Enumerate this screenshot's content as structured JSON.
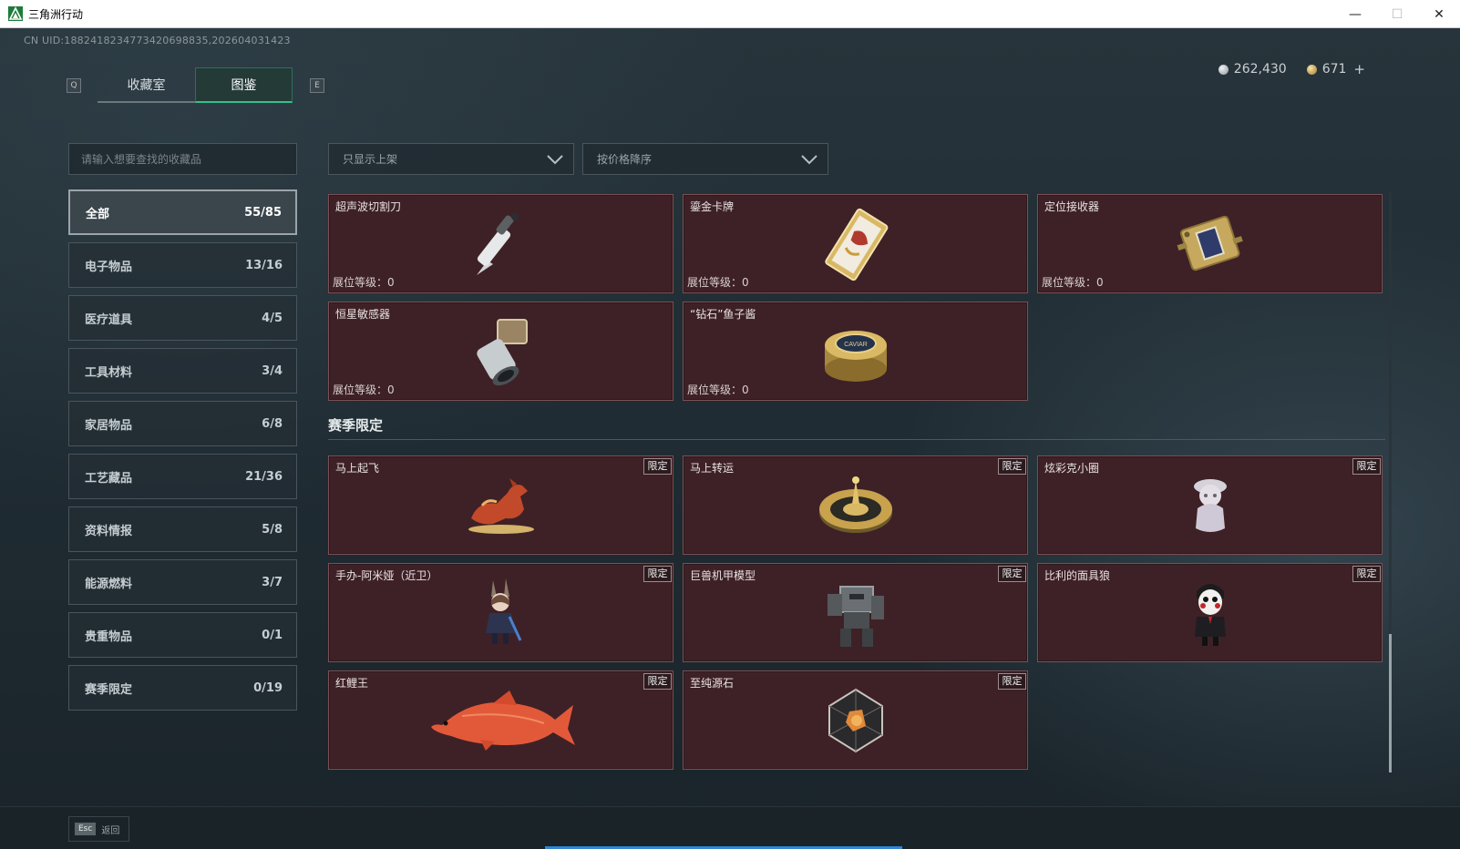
{
  "window": {
    "title": "三角洲行动",
    "minimize": "—",
    "maximize": "☐",
    "close": "✕"
  },
  "uid": "CN UID:1882418234773420698835,202604031423",
  "currency": {
    "silver": "262,430",
    "gold": "671",
    "plus": "+"
  },
  "tabs": {
    "prev_key": "Q",
    "next_key": "E",
    "items": [
      {
        "label": "收藏室"
      },
      {
        "label": "图鉴",
        "active": true
      }
    ]
  },
  "search": {
    "placeholder": "请输入想要查找的收藏品"
  },
  "categories": [
    {
      "label": "全部",
      "count": "55/85",
      "active": true
    },
    {
      "label": "电子物品",
      "count": "13/16"
    },
    {
      "label": "医疗道具",
      "count": "4/5"
    },
    {
      "label": "工具材料",
      "count": "3/4"
    },
    {
      "label": "家居物品",
      "count": "6/8"
    },
    {
      "label": "工艺藏品",
      "count": "21/36"
    },
    {
      "label": "资料情报",
      "count": "5/8"
    },
    {
      "label": "能源燃料",
      "count": "3/7"
    },
    {
      "label": "贵重物品",
      "count": "0/1"
    },
    {
      "label": "赛季限定",
      "count": "0/19"
    }
  ],
  "filters": {
    "shelf": "只显示上架",
    "sort": "按价格降序"
  },
  "level_label": "展位等级：",
  "level_value": "0",
  "limited_label": "限定",
  "items": [
    {
      "name": "超声波切割刀",
      "level": "0",
      "icon": "ultrasonic-knife-icon"
    },
    {
      "name": "鎏金卡牌",
      "level": "0",
      "icon": "gilded-card-icon"
    },
    {
      "name": "定位接收器",
      "level": "0",
      "icon": "locator-receiver-icon"
    },
    {
      "name": "恒星敏感器",
      "level": "0",
      "icon": "star-sensor-icon"
    },
    {
      "name": "“钻石”鱼子酱",
      "level": "0",
      "icon": "caviar-tin-icon",
      "caviar_text": "CAVIAR"
    }
  ],
  "season_section": {
    "title": "赛季限定"
  },
  "season_items": [
    {
      "name": "马上起飞",
      "icon": "horse-figure-icon"
    },
    {
      "name": "马上转运",
      "icon": "fortune-wheel-icon"
    },
    {
      "name": "炫彩克小圈",
      "icon": "figurine-icon"
    },
    {
      "name": "手办-阿米娅（近卫）",
      "icon": "amiya-figure-icon"
    },
    {
      "name": "巨兽机甲模型",
      "icon": "mech-model-icon"
    },
    {
      "name": "比利的面具狼",
      "icon": "billy-puppet-icon"
    },
    {
      "name": "红鲤王",
      "icon": "red-carp-icon"
    },
    {
      "name": "至纯源石",
      "icon": "originium-icon"
    }
  ],
  "bottom": {
    "esc_key": "Esc",
    "esc_label": "返回"
  },
  "colors": {
    "card_bg": "#3e2126",
    "accent": "#35c088",
    "progress": "#2f86d6"
  }
}
